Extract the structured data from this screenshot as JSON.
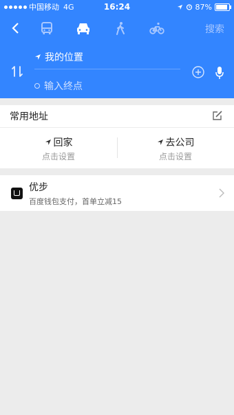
{
  "status_bar": {
    "carrier": "中国移动",
    "network": "4G",
    "time": "16:24",
    "battery": "87%",
    "battery_level": 0.87
  },
  "nav": {
    "search_label": "搜索",
    "modes": [
      "bus-icon",
      "car-icon",
      "walk-icon",
      "bike-icon"
    ],
    "selected_mode": "car"
  },
  "route": {
    "start_label": "我的位置",
    "end_placeholder": "输入终点"
  },
  "favorites": {
    "title": "常用地址",
    "items": [
      {
        "name": "回家",
        "sub": "点击设置"
      },
      {
        "name": "去公司",
        "sub": "点击设置"
      }
    ]
  },
  "promo": {
    "title": "优步",
    "desc": "百度钱包支付，首单立减15"
  },
  "colors": {
    "accent": "#3385ff",
    "background": "#ececec"
  }
}
